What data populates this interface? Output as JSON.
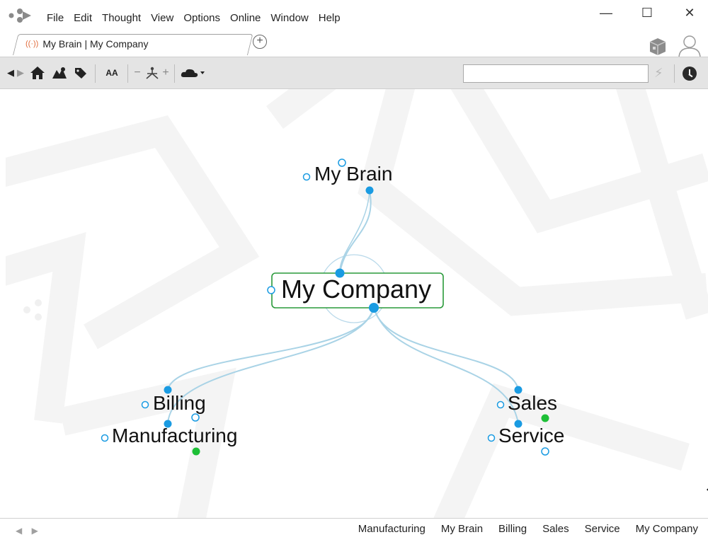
{
  "menu": [
    "File",
    "Edit",
    "Thought",
    "View",
    "Options",
    "Online",
    "Window",
    "Help"
  ],
  "window_controls": {
    "minimize": "—",
    "maximize": "☐",
    "close": "✕"
  },
  "tab": {
    "title": "My Brain | My Company",
    "live_icon": "((·))"
  },
  "add_tab_icon": "plus-circle-icon",
  "toolbar": {
    "back": "◀",
    "forward": "▶",
    "font_label": "AA",
    "zoom_minus": "−",
    "zoom_plus": "+",
    "search_value": ""
  },
  "map": {
    "central": "My Company",
    "parent": "My Brain",
    "children_left": [
      "Billing",
      "Manufacturing"
    ],
    "children_right": [
      "Sales",
      "Service"
    ],
    "colors": {
      "link": "#a9d3e6",
      "gate_filled": "#1a9be2",
      "gate_open": "#1a9be2",
      "note": "#1dbf36",
      "active_border": "#2a9a3a"
    }
  },
  "statusbar": {
    "back": "◀",
    "forward": "▶",
    "history": [
      "Manufacturing",
      "My Brain",
      "Billing",
      "Sales",
      "Service",
      "My Company"
    ]
  }
}
